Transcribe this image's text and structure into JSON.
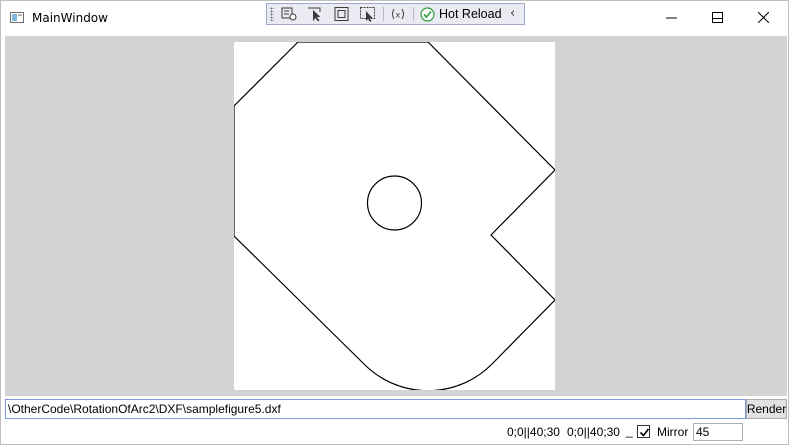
{
  "window": {
    "title": "MainWindow"
  },
  "toolbar": {
    "icons": [
      "select-element-icon",
      "pointer-select-icon",
      "layout-adorner-icon",
      "track-focus-icon",
      "binding-failures-icon",
      "hot-reload-check-icon",
      "collapse-chevron-icon"
    ],
    "hot_reload_label": "Hot Reload",
    "collapse_glyph": "‹"
  },
  "figure": {
    "file": "samplefigure5.dxf"
  },
  "path": {
    "value": "\\OtherCode\\RotationOfArc2\\DXF\\samplefigure5.dxf"
  },
  "render_button": {
    "label": "Render"
  },
  "status": {
    "coords_1": "0;0||40;30",
    "coords_2": "0;0||40;30",
    "underscore": "_"
  },
  "mirror": {
    "label": "Mirror",
    "checked": true
  },
  "angle": {
    "value": "45"
  },
  "colors": {
    "canvas_bg": "#d3d3d3",
    "input_border": "#7a9bd8",
    "check_green": "#2e9e3e"
  }
}
